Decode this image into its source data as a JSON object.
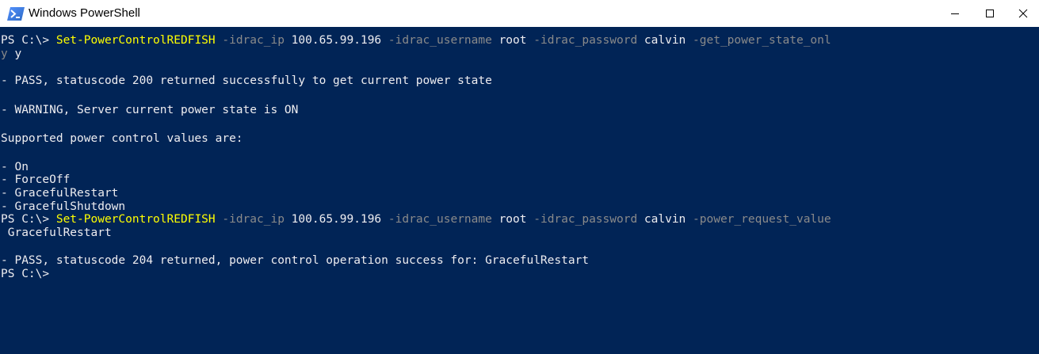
{
  "window": {
    "title": "Windows PowerShell",
    "icons": {
      "app": "powershell-icon",
      "minimize": "minimize-icon",
      "maximize": "maximize-icon",
      "close": "close-icon"
    },
    "colors": {
      "console_bg": "#012456",
      "text": "#eeedf0",
      "command": "#ffff00",
      "parameter": "#8a8a8a",
      "titlebar": "#ffffff"
    }
  },
  "console": {
    "cmd1": {
      "prompt": "PS C:\\> ",
      "command": "Set-PowerControlREDFISH",
      "p1": " -idrac_ip ",
      "v1": "100.65.99.196",
      "p2": " -idrac_username ",
      "v2": "root",
      "p3": " -idrac_password ",
      "v3": "calvin",
      "p4": " -get_power_state_onl",
      "wrap_param": "y",
      "wrap_value": " y"
    },
    "out1": "- PASS, statuscode 200 returned successfully to get current power state",
    "out2": "- WARNING, Server current power state is ON",
    "out3": "Supported power control values are:",
    "values": [
      "- On",
      "- ForceOff",
      "- GracefulRestart",
      "- GracefulShutdown"
    ],
    "cmd2": {
      "prompt": "PS C:\\> ",
      "command": "Set-PowerControlREDFISH",
      "p1": " -idrac_ip ",
      "v1": "100.65.99.196",
      "p2": " -idrac_username ",
      "v2": "root",
      "p3": " -idrac_password ",
      "v3": "calvin",
      "p4": " -power_request_value",
      "wrap_value": " GracefulRestart"
    },
    "out4": "- PASS, statuscode 204 returned, power control operation success for: GracefulRestart",
    "final_prompt": "PS C:\\>"
  }
}
